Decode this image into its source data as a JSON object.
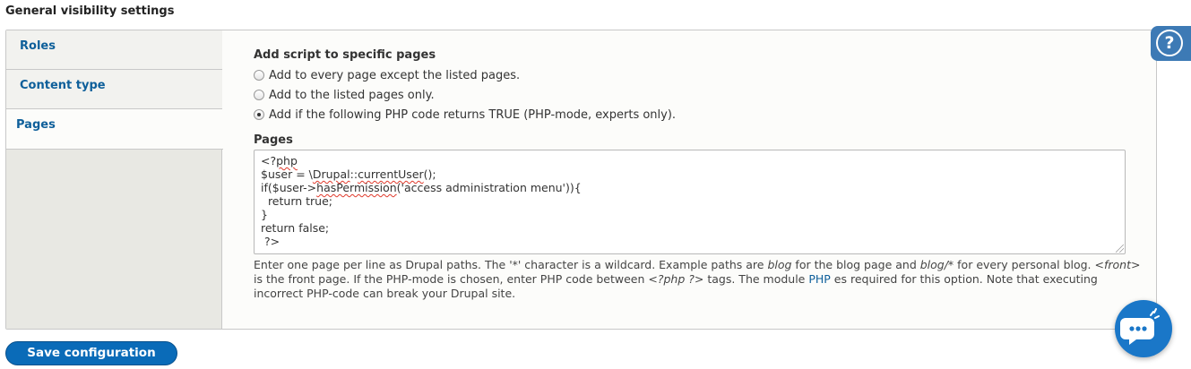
{
  "section": {
    "title": "General visibility settings"
  },
  "tabs": [
    {
      "label": "Roles",
      "active": false
    },
    {
      "label": "Content type",
      "active": false
    },
    {
      "label": "Pages",
      "active": true
    }
  ],
  "pages_pane": {
    "heading": "Add script to specific pages",
    "options": [
      {
        "label": "Add to every page except the listed pages.",
        "checked": false
      },
      {
        "label": "Add to the listed pages only.",
        "checked": false
      },
      {
        "label": "Add if the following PHP code returns TRUE (PHP-mode, experts only).",
        "checked": true
      }
    ],
    "pages_label": "Pages",
    "code": {
      "line1_a": "<?",
      "line1_b": "php",
      "line2_a": "$user = \\",
      "line2_b": "Drupal",
      "line2_c": "::",
      "line2_d": "currentUser",
      "line2_e": "();",
      "line3_a": "if($user->",
      "line3_b": "hasPermission",
      "line3_c": "('access administration menu')){",
      "line4": "  return true;",
      "line5": "}",
      "line6": "return false;",
      "line7": " ?>"
    },
    "description": {
      "t1": "Enter one page per line as Drupal paths. The '*' character is a wildcard. Example paths are ",
      "em1": "blog",
      "t2": " for the blog page and ",
      "em2": "blog/*",
      "t3": " for every personal blog. ",
      "em3": "<front>",
      "t4": " is the front page. If the PHP-mode is chosen, enter PHP code between ",
      "em4": "<?php ?>",
      "t5": " tags. The module ",
      "link": "PHP",
      "t6": " es required for this option. Note that executing incorrect PHP-code can break your Drupal site."
    }
  },
  "actions": {
    "save_label": "Save configuration"
  },
  "help": {
    "glyph": "?"
  },
  "colors": {
    "accent": "#0a6bb8",
    "link": "#0e5f9a",
    "chat": "#1a77c8"
  },
  "icons": {
    "help": "help-icon",
    "chat": "chat-bubble-icon"
  }
}
